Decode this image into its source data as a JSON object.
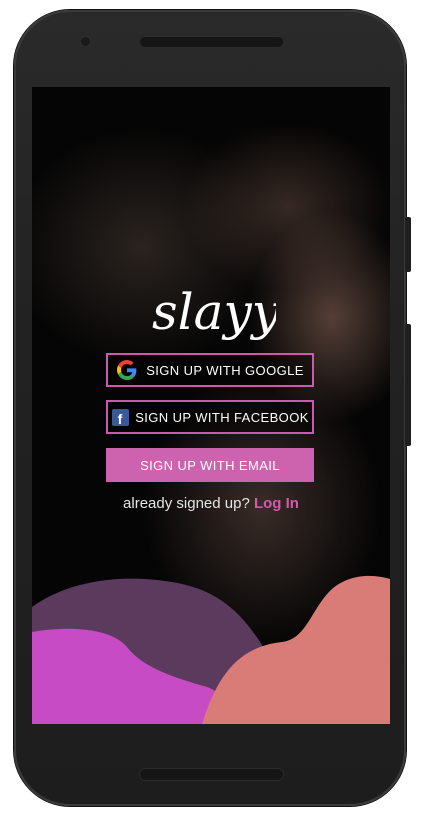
{
  "app": {
    "logo_text": "slayy"
  },
  "auth": {
    "google_label": "SIGN UP WITH GOOGLE",
    "facebook_label": "SIGN UP WITH FACEBOOK",
    "email_label": "SIGN UP WITH EMAIL",
    "already_text": "already signed up?",
    "login_label": "Log In"
  },
  "icons": {
    "google": "google-icon",
    "facebook": "facebook-icon"
  },
  "colors": {
    "accent_pink": "#cd62af",
    "login_link": "#d25aa9",
    "blob_purple_dark": "#5b3a5d",
    "blob_magenta": "#c84bc6",
    "blob_salmon": "#d97c78",
    "facebook_blue": "#3b5998"
  }
}
